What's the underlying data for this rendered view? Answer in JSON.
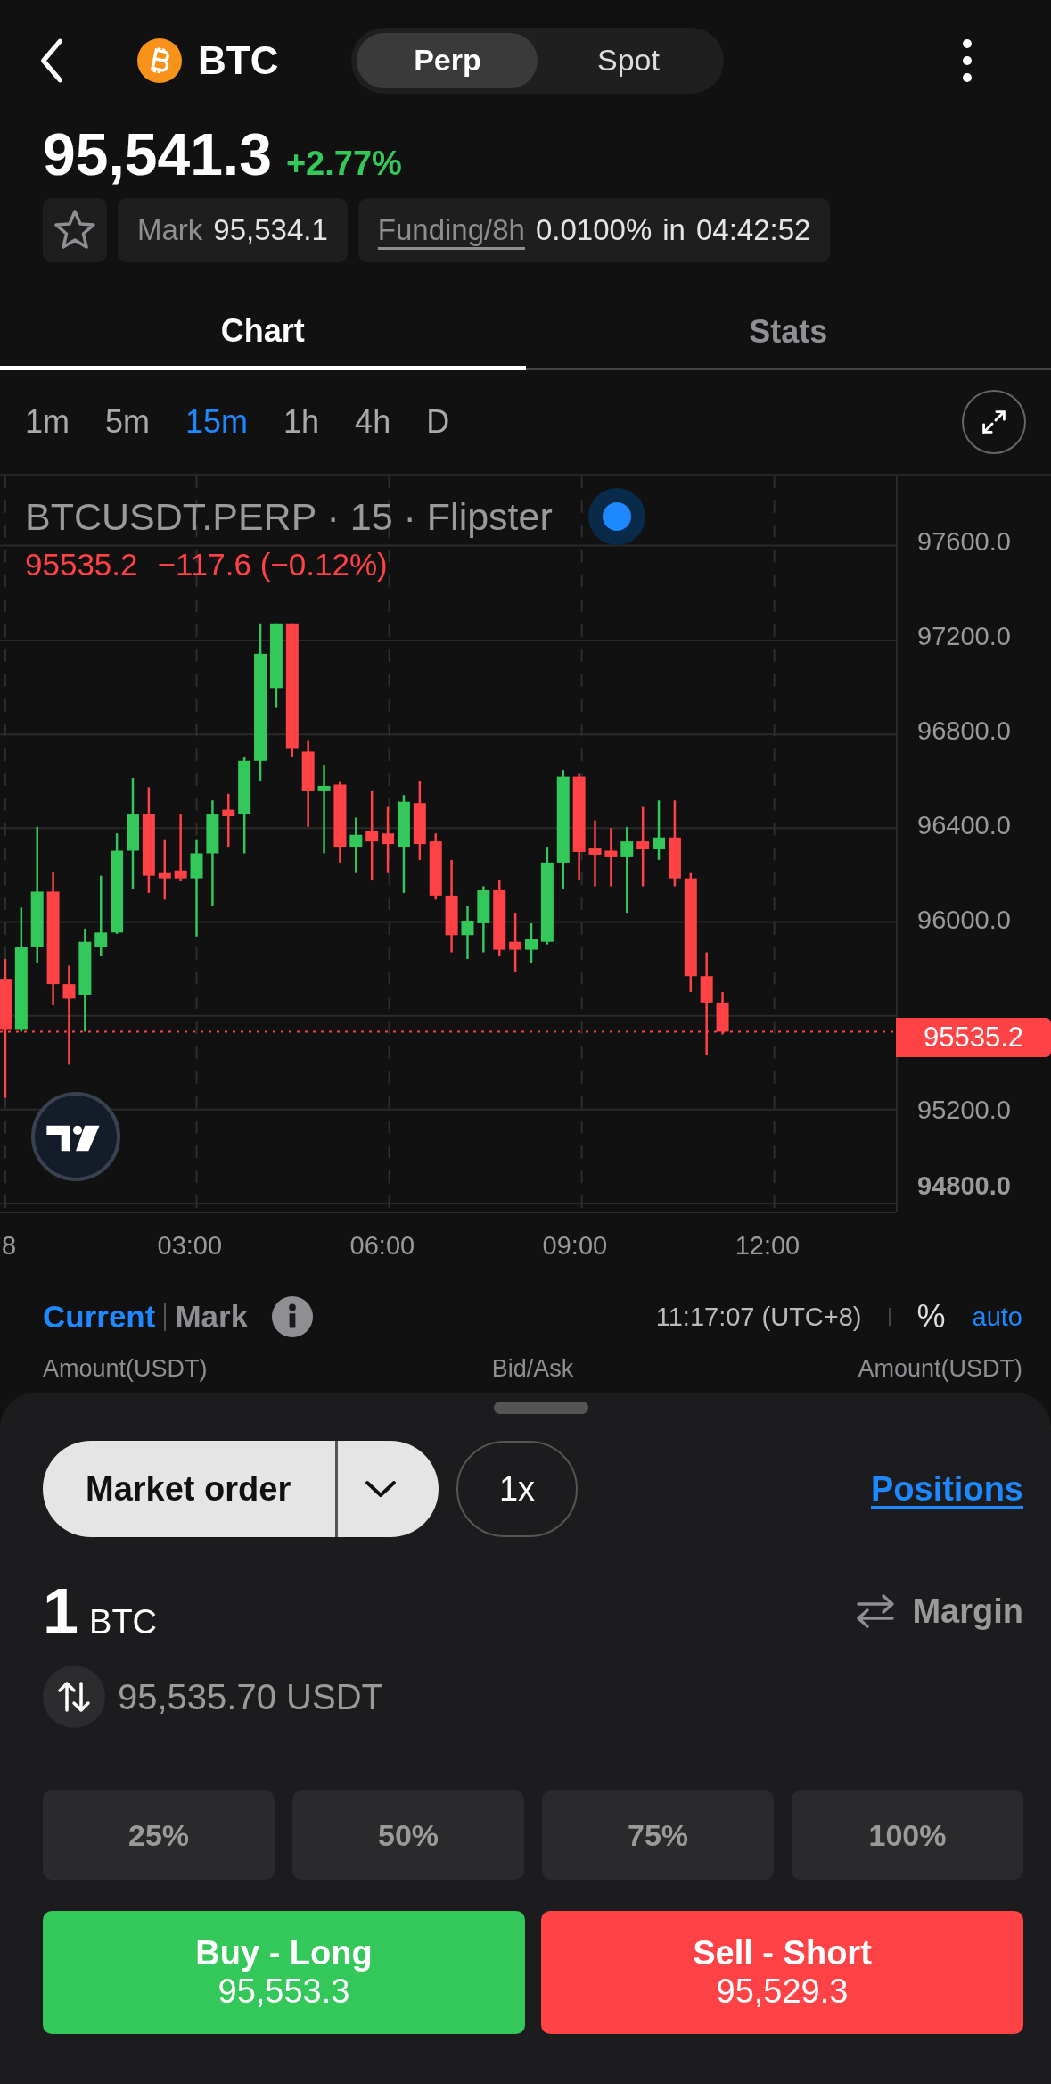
{
  "header": {
    "symbol": "BTC",
    "market_types": [
      {
        "label": "Perp",
        "selected": true
      },
      {
        "label": "Spot",
        "selected": false
      }
    ]
  },
  "price": {
    "last": "95,541.3",
    "change": "+2.77%"
  },
  "info": {
    "favorite": false,
    "mark_label": "Mark",
    "mark_value": "95,534.1",
    "funding_label": "Funding/8h",
    "funding_rate": "0.0100%",
    "funding_in": "in",
    "funding_countdown": "04:42:52"
  },
  "tabs": [
    {
      "label": "Chart",
      "selected": true
    },
    {
      "label": "Stats",
      "selected": false
    }
  ],
  "intervals": [
    {
      "label": "1m",
      "selected": false
    },
    {
      "label": "5m",
      "selected": false
    },
    {
      "label": "15m",
      "selected": true
    },
    {
      "label": "1h",
      "selected": false
    },
    {
      "label": "4h",
      "selected": false
    },
    {
      "label": "D",
      "selected": false
    }
  ],
  "chart": {
    "title": "BTCUSDT.PERP · 15 · Flipster",
    "last_close": "95535.2",
    "last_change": "−117.6 (−0.12%)",
    "price_tag": "95535.2",
    "price_labels": [
      "97600.0",
      "97200.0",
      "96800.0",
      "96400.0",
      "96000.0",
      "95200.0",
      "94800.0"
    ],
    "time_labels": [
      "8",
      "03:00",
      "06:00",
      "09:00",
      "12:00"
    ]
  },
  "price_source": [
    {
      "label": "Current",
      "selected": true
    },
    {
      "label": "Mark",
      "selected": false
    }
  ],
  "clock": "11:17:07 (UTC+8)",
  "percent_toggle": "%",
  "auto_toggle": "auto",
  "book_columns": [
    "Amount(USDT)",
    "Bid/Ask",
    "Amount(USDT)"
  ],
  "order": {
    "type": "Market order",
    "leverage": "1x",
    "positions_link": "Positions",
    "amount": "1",
    "amount_unit": "BTC",
    "margin_toggle": "Margin",
    "notional": "95,535.70 USDT",
    "fractions": [
      "25%",
      "50%",
      "75%",
      "100%"
    ],
    "buy": {
      "label": "Buy - Long",
      "price": "95,553.3"
    },
    "sell": {
      "label": "Sell - Short",
      "price": "95,529.3"
    }
  }
}
